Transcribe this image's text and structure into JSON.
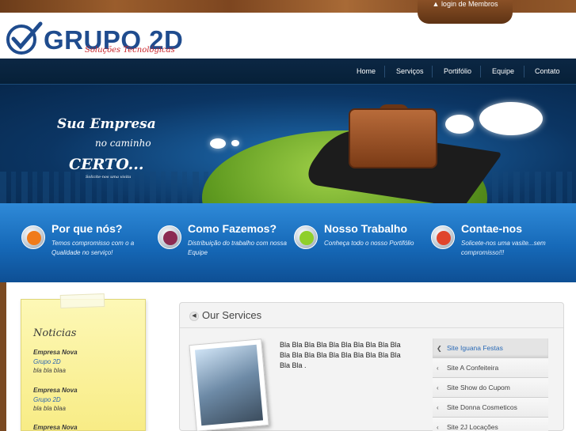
{
  "header": {
    "login_label": "login de Membros",
    "logo_text": "GRUPO 2D",
    "logo_subtitle": "Soluções Tecnológicas"
  },
  "nav": {
    "items": [
      "Home",
      "Serviços",
      "Portifólio",
      "Equipe",
      "Contato"
    ]
  },
  "hero": {
    "line1": "Sua Empresa",
    "line2": "no caminho",
    "line3": "CERTO...",
    "line4": "Solicite-nos uma visita"
  },
  "features": [
    {
      "title": "Por que nós?",
      "text": "Temos compromisso com o a Qualidade no serviço!",
      "icon": "check-icon",
      "color": "#f07b1a"
    },
    {
      "title": "Como Fazemos?",
      "text": "Distribuição do trabalho com nossa Equipe",
      "icon": "pen-icon",
      "color": "#8c2b52"
    },
    {
      "title": "Nosso Trabalho",
      "text": "Conheça todo o nosso Portifólio",
      "icon": "play-icon",
      "color": "#8fcf2a"
    },
    {
      "title": "Contae-nos",
      "text": "Solicete-nos uma vasite...sem compromisso!!!",
      "icon": "phone-icon",
      "color": "#e0452c"
    }
  ],
  "news": {
    "title": "Noticias",
    "items": [
      {
        "title": "Empresa Nova",
        "subtitle": "Grupo 2D",
        "desc": "bla bla blaa"
      },
      {
        "title": "Empresa Nova",
        "subtitle": "Grupo 2D",
        "desc": "bla bla blaa"
      },
      {
        "title": "Empresa Nova",
        "subtitle": "",
        "desc": ""
      }
    ]
  },
  "services": {
    "title": "Our Services",
    "text": "Bla Bla Bla Bla Bla Bla Bla Bla Bla Bla Bla Bla Bla Bla Bla Bla Bla Bla Bla Bla Bla Bla .",
    "items": [
      "Site Iguana Festas",
      "Site A Confeiteira",
      "Site Show do Cupom",
      "Site Donna Cosmeticos",
      "Site 2J Locações"
    ],
    "active_index": 0
  },
  "colors": {
    "brand_blue": "#1f4c8e",
    "nav_bg": "#0c2744",
    "feature_band": "#1669b8"
  }
}
